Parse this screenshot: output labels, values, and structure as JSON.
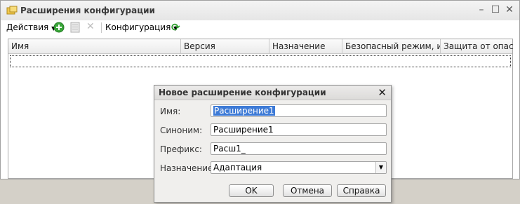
{
  "window": {
    "title": "Расширения конфигурации"
  },
  "toolbar": {
    "actions_label": "Действия",
    "configuration_label": "Конфигурация"
  },
  "table": {
    "columns": [
      "Имя",
      "Версия",
      "Назначение",
      "Безопасный режим, им...",
      "Защита от опасн..."
    ]
  },
  "dialog": {
    "title": "Новое расширение конфигурации",
    "fields": {
      "name": {
        "label": "Имя:",
        "value": "Расширение1"
      },
      "synonym": {
        "label": "Синоним:",
        "value": "Расширение1"
      },
      "prefix": {
        "label": "Префикс:",
        "value": "Расш1_"
      },
      "purpose": {
        "label": "Назначение:",
        "value": "Адаптация"
      }
    },
    "buttons": {
      "ok": "OK",
      "cancel": "Отмена",
      "help": "Справка"
    }
  },
  "colors": {
    "accent_green": "#2e9e2e",
    "selection": "#3d7ad6"
  }
}
